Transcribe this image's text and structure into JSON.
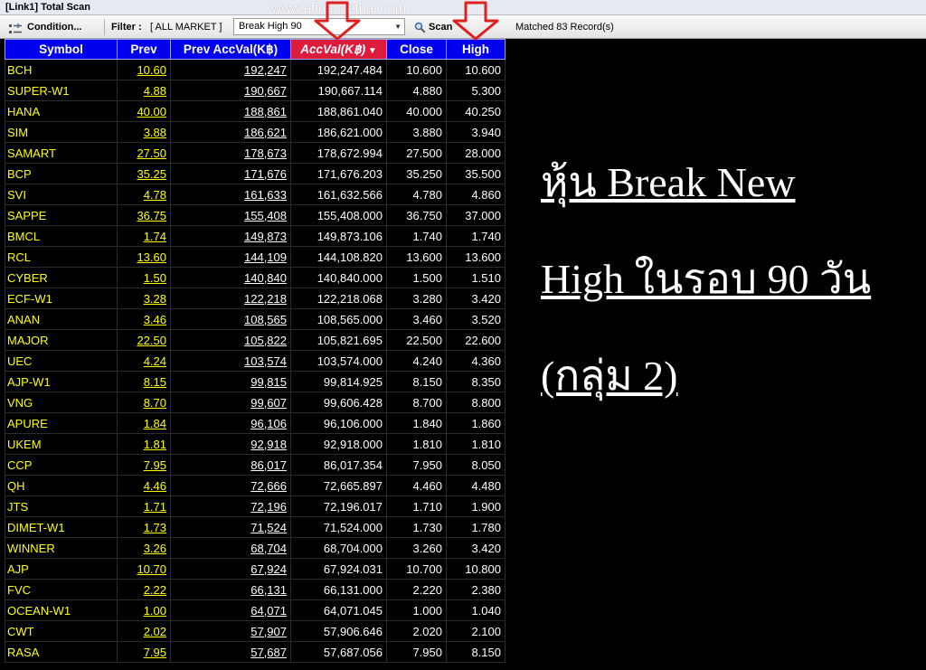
{
  "window": {
    "title": "[Link1] Total Scan"
  },
  "watermark": "www.efinancethai.com",
  "toolbar": {
    "condition_label": "Condition...",
    "filter_label": "Filter :",
    "filter_value": "[ ALL MARKET ]",
    "scan_type": "Break High 90",
    "scan_label": "Scan",
    "matched_text": "Matched 83 Record(s)"
  },
  "table": {
    "headers": {
      "symbol": "Symbol",
      "prev": "Prev",
      "prev_accval": "Prev AccVal(K฿)",
      "accval": "AccVal(K฿)",
      "close": "Close",
      "high": "High"
    },
    "rows": [
      {
        "symbol": "BCH",
        "prev": "10.60",
        "prev_accval": "192,247",
        "accval": "192,247.484",
        "close": "10.600",
        "high": "10.600"
      },
      {
        "symbol": "SUPER-W1",
        "prev": "4.88",
        "prev_accval": "190,667",
        "accval": "190,667.114",
        "close": "4.880",
        "high": "5.300"
      },
      {
        "symbol": "HANA",
        "prev": "40.00",
        "prev_accval": "188,861",
        "accval": "188,861.040",
        "close": "40.000",
        "high": "40.250"
      },
      {
        "symbol": "SIM",
        "prev": "3.88",
        "prev_accval": "186,621",
        "accval": "186,621.000",
        "close": "3.880",
        "high": "3.940"
      },
      {
        "symbol": "SAMART",
        "prev": "27.50",
        "prev_accval": "178,673",
        "accval": "178,672.994",
        "close": "27.500",
        "high": "28.000"
      },
      {
        "symbol": "BCP",
        "prev": "35.25",
        "prev_accval": "171,676",
        "accval": "171,676.203",
        "close": "35.250",
        "high": "35.500"
      },
      {
        "symbol": "SVI",
        "prev": "4.78",
        "prev_accval": "161,633",
        "accval": "161,632.566",
        "close": "4.780",
        "high": "4.860"
      },
      {
        "symbol": "SAPPE",
        "prev": "36.75",
        "prev_accval": "155,408",
        "accval": "155,408.000",
        "close": "36.750",
        "high": "37.000"
      },
      {
        "symbol": "BMCL",
        "prev": "1.74",
        "prev_accval": "149,873",
        "accval": "149,873.106",
        "close": "1.740",
        "high": "1.740"
      },
      {
        "symbol": "RCL",
        "prev": "13.60",
        "prev_accval": "144,109",
        "accval": "144,108.820",
        "close": "13.600",
        "high": "13.600"
      },
      {
        "symbol": "CYBER",
        "prev": "1.50",
        "prev_accval": "140,840",
        "accval": "140,840.000",
        "close": "1.500",
        "high": "1.510"
      },
      {
        "symbol": "ECF-W1",
        "prev": "3.28",
        "prev_accval": "122,218",
        "accval": "122,218.068",
        "close": "3.280",
        "high": "3.420"
      },
      {
        "symbol": "ANAN",
        "prev": "3.46",
        "prev_accval": "108,565",
        "accval": "108,565.000",
        "close": "3.460",
        "high": "3.520"
      },
      {
        "symbol": "MAJOR",
        "prev": "22.50",
        "prev_accval": "105,822",
        "accval": "105,821.695",
        "close": "22.500",
        "high": "22.600"
      },
      {
        "symbol": "UEC",
        "prev": "4.24",
        "prev_accval": "103,574",
        "accval": "103,574.000",
        "close": "4.240",
        "high": "4.360"
      },
      {
        "symbol": "AJP-W1",
        "prev": "8.15",
        "prev_accval": "99,815",
        "accval": "99,814.925",
        "close": "8.150",
        "high": "8.350"
      },
      {
        "symbol": "VNG",
        "prev": "8.70",
        "prev_accval": "99,607",
        "accval": "99,606.428",
        "close": "8.700",
        "high": "8.800"
      },
      {
        "symbol": "APURE",
        "prev": "1.84",
        "prev_accval": "96,106",
        "accval": "96,106.000",
        "close": "1.840",
        "high": "1.860"
      },
      {
        "symbol": "UKEM",
        "prev": "1.81",
        "prev_accval": "92,918",
        "accval": "92,918.000",
        "close": "1.810",
        "high": "1.810"
      },
      {
        "symbol": "CCP",
        "prev": "7.95",
        "prev_accval": "86,017",
        "accval": "86,017.354",
        "close": "7.950",
        "high": "8.050"
      },
      {
        "symbol": "QH",
        "prev": "4.46",
        "prev_accval": "72,666",
        "accval": "72,665.897",
        "close": "4.460",
        "high": "4.480"
      },
      {
        "symbol": "JTS",
        "prev": "1.71",
        "prev_accval": "72,196",
        "accval": "72,196.017",
        "close": "1.710",
        "high": "1.900"
      },
      {
        "symbol": "DIMET-W1",
        "prev": "1.73",
        "prev_accval": "71,524",
        "accval": "71,524.000",
        "close": "1.730",
        "high": "1.780"
      },
      {
        "symbol": "WINNER",
        "prev": "3.26",
        "prev_accval": "68,704",
        "accval": "68,704.000",
        "close": "3.260",
        "high": "3.420"
      },
      {
        "symbol": "AJP",
        "prev": "10.70",
        "prev_accval": "67,924",
        "accval": "67,924.031",
        "close": "10.700",
        "high": "10.800"
      },
      {
        "symbol": "FVC",
        "prev": "2.22",
        "prev_accval": "66,131",
        "accval": "66,131.000",
        "close": "2.220",
        "high": "2.380"
      },
      {
        "symbol": "OCEAN-W1",
        "prev": "1.00",
        "prev_accval": "64,071",
        "accval": "64,071.045",
        "close": "1.000",
        "high": "1.040"
      },
      {
        "symbol": "CWT",
        "prev": "2.02",
        "prev_accval": "57,907",
        "accval": "57,906.646",
        "close": "2.020",
        "high": "2.100"
      },
      {
        "symbol": "RASA",
        "prev": "7.95",
        "prev_accval": "57,687",
        "accval": "57,687.056",
        "close": "7.950",
        "high": "8.150"
      }
    ]
  },
  "caption": {
    "line1": "หุ้น Break New",
    "line2": "High ในรอบ 90 วัน",
    "line3": "(กลุ่ม 2)"
  },
  "colors": {
    "header_bg": "#0000ee",
    "sorted_header_bg": "#dd1b3c",
    "symbol_text": "#ffff00",
    "grid_bg": "#000000",
    "annotation_arrow": "#e02020"
  }
}
